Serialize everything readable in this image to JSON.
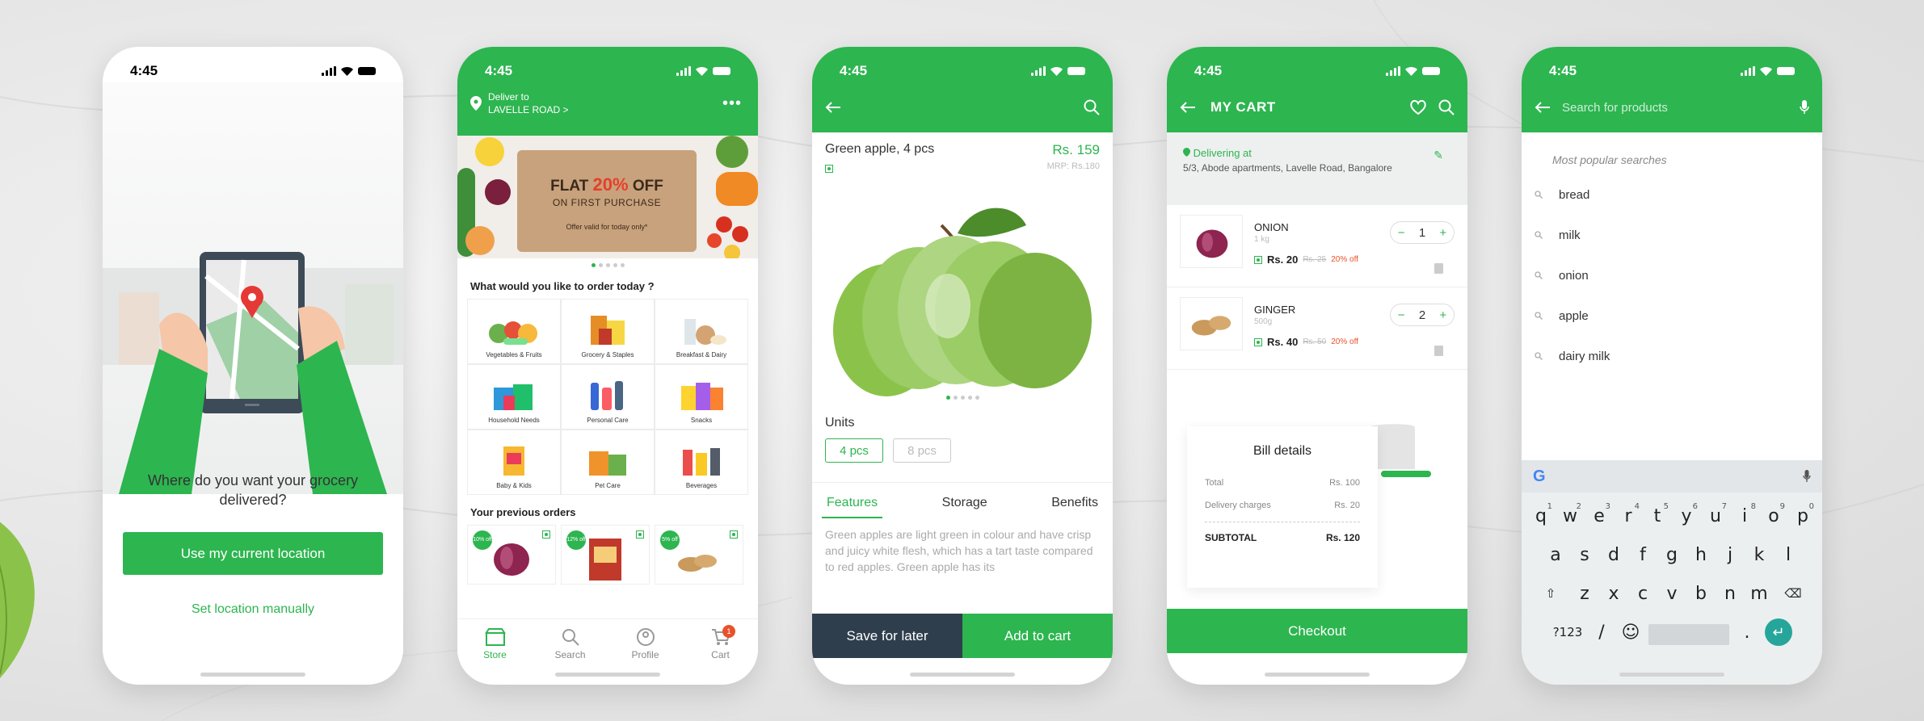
{
  "status_time": "4:45",
  "colors": {
    "brand_green": "#2db550",
    "dark_button": "#2e3e4d",
    "offer_red": "#e8522a"
  },
  "screen1": {
    "question": "Where do you want your grocery delivered?",
    "use_location": "Use my current location",
    "set_manually": "Set location manually"
  },
  "screen2": {
    "deliver_to": "Deliver to",
    "location": "LAVELLE ROAD >",
    "banner": {
      "flat": "FLAT",
      "percent": "20%",
      "off": "OFF",
      "subtitle": "ON FIRST PURCHASE",
      "note": "Offer valid for today only*"
    },
    "order_title": "What would you like to order today ?",
    "categories": [
      "Vegetables & Fruits",
      "Grocery & Staples",
      "Breakfast & Dairy",
      "Household Needs",
      "Personal Care",
      "Snacks",
      "Baby & Kids",
      "Pet Care",
      "Beverages"
    ],
    "previous_title": "Your previous orders",
    "previous_discounts": [
      "10% off",
      "12% off",
      "5% off"
    ],
    "tabs": [
      "Store",
      "Search",
      "Profile",
      "Cart"
    ],
    "cart_badge": "1"
  },
  "screen3": {
    "product_name": "Green apple, 4 pcs",
    "price": "Rs. 159",
    "mrp": "MRP: Rs.180",
    "units_title": "Units",
    "units": [
      "4 pcs",
      "8 pcs"
    ],
    "tabs": [
      "Features",
      "Storage",
      "Benefits"
    ],
    "description": "Green apples are light green in colour and have crisp and juicy white flesh, which has a tart taste compared to red apples. Green apple has its",
    "save_later": "Save for later",
    "add_cart": "Add to cart"
  },
  "screen4": {
    "title": "MY CART",
    "delivering_at": "Delivering at",
    "address": "5/3, Abode apartments, Lavelle Road, Bangalore",
    "items": [
      {
        "name": "ONION",
        "qty": "1 kg",
        "price": "Rs. 20",
        "mrp": "Rs. 25",
        "off": "20% off",
        "count": "1"
      },
      {
        "name": "GINGER",
        "qty": "500g",
        "price": "Rs. 40",
        "mrp": "Rs. 50",
        "off": "20% off",
        "count": "2"
      }
    ],
    "bill": {
      "title": "Bill details",
      "total_label": "Total",
      "total_value": "Rs. 100",
      "delivery_label": "Delivery charges",
      "delivery_value": "Rs. 20",
      "subtotal_label": "SUBTOTAL",
      "subtotal_value": "Rs. 120"
    },
    "checkout": "Checkout"
  },
  "screen5": {
    "search_placeholder": "Search for products",
    "popular_title": "Most popular searches",
    "suggestions": [
      "bread",
      "milk",
      "onion",
      "apple",
      "dairy milk"
    ],
    "keyboard": {
      "row1": [
        "q",
        "w",
        "e",
        "r",
        "t",
        "y",
        "u",
        "i",
        "o",
        "p"
      ],
      "row1_digits": [
        "1",
        "2",
        "3",
        "4",
        "5",
        "6",
        "7",
        "8",
        "9",
        "0"
      ],
      "row2": [
        "a",
        "s",
        "d",
        "f",
        "g",
        "h",
        "j",
        "k",
        "l"
      ],
      "row3": [
        "z",
        "x",
        "c",
        "v",
        "b",
        "n",
        "m"
      ],
      "sym": "?123",
      "slash": "/",
      "dot": "."
    }
  }
}
